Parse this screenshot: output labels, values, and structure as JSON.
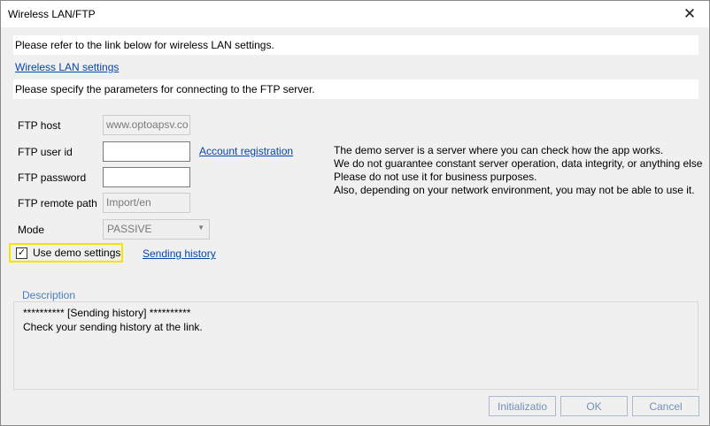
{
  "window": {
    "title": "Wireless LAN/FTP",
    "close_glyph": "✕",
    "close_icon": "close-icon"
  },
  "intro": {
    "wlan_text": "Please refer to the link below for wireless LAN settings.",
    "wlan_link": "Wireless LAN settings",
    "ftp_text": "Please specify the parameters for connecting to the FTP server."
  },
  "form": {
    "host_label": "FTP host",
    "host_value": "www.optoapsv.co",
    "user_label": "FTP user id",
    "user_value": "",
    "account_link": "Account registration",
    "password_label": "FTP password",
    "password_value": "",
    "remote_label": "FTP remote path",
    "remote_value": "Import/en",
    "mode_label": "Mode",
    "mode_value": "PASSIVE",
    "mode_arrow": "▼",
    "demo_check": "✓",
    "demo_checked": true,
    "demo_label": "Use demo settings",
    "history_link": "Sending history"
  },
  "info": {
    "lines": [
      "The demo server is a server where you can check how the app works.",
      "We do not guarantee constant server operation, data integrity, or anything else",
      "Please do not use it for business purposes.",
      "Also, depending on your network environment, you may not be able to use it."
    ]
  },
  "description": {
    "legend": "Description",
    "line1": "**********  [Sending history]  **********",
    "line2": "Check your sending history at the link."
  },
  "buttons": {
    "init": "Initializatio",
    "ok": "OK",
    "cancel": "Cancel"
  }
}
